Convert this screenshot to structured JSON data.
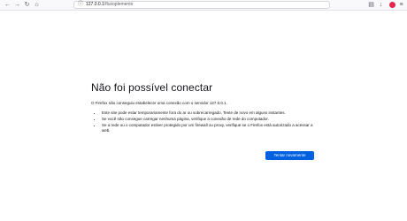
{
  "toolbar": {
    "back_icon": "back-arrow-icon",
    "forward_icon": "forward-arrow-icon",
    "reload_icon": "reload-icon",
    "home_icon": "home-icon",
    "url_host": "127.0.0.1",
    "url_path": "/fluxoplemento",
    "right_icons": [
      "extensions-icon",
      "account-icon",
      "menu-icon"
    ]
  },
  "error": {
    "title": "Não foi possível conectar",
    "description": "O Firefox não conseguiu estabelecer uma conexão com o servidor 127.0.0.1.",
    "items": [
      "Este site pode estar temporariamente fora do ar ou sobrecarregado. Tente de novo em alguns instantes.",
      "Se você não consegue carregar nenhuma página, verifique a conexão de rede do computador.",
      "Se a rede ou o computador estiver protegido por um firewall ou proxy, verifique se o Firefox está autorizado a acessar a web."
    ],
    "retry_label": "Tentar novamente"
  },
  "colors": {
    "accent": "#0061e0",
    "avatar": "#e22850"
  }
}
